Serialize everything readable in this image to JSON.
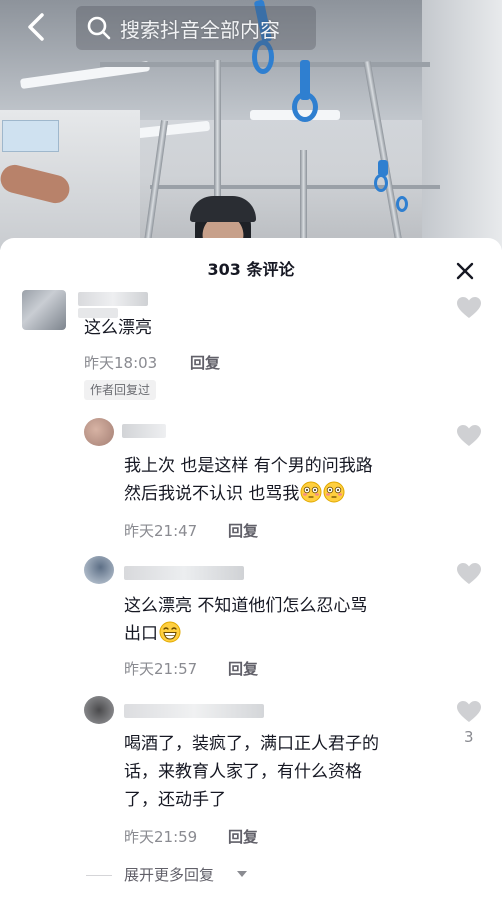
{
  "search": {
    "placeholder": "搜索抖音全部内容"
  },
  "comments_panel": {
    "title": "303 条评论",
    "comments": [
      {
        "text": "这么漂亮",
        "time": "昨天18:03",
        "reply_label": "回复",
        "badge": "作者回复过"
      }
    ],
    "replies": [
      {
        "text_line1": "我上次 也是这样 有个男的问我路",
        "text_line2": "然后我说不认识 也骂我",
        "emoji": [
          "flushed-face",
          "flushed-face"
        ],
        "time": "昨天21:47",
        "reply_label": "回复"
      },
      {
        "text_line1": "这么漂亮 不知道他们怎么忍心骂",
        "text_line2": "出口",
        "emoji": [
          "grinning-face"
        ],
        "time": "昨天21:57",
        "reply_label": "回复"
      },
      {
        "text_line1": "喝酒了，装疯了，满口正人君子的",
        "text_line2": "话，来教育人家了，有什么资格",
        "text_line3": "了，还动手了",
        "time": "昨天21:59",
        "reply_label": "回复",
        "likes": "3"
      }
    ],
    "expand_label": "展开更多回复"
  },
  "colors": {
    "text_primary": "#161823",
    "text_secondary": "#8a8b91",
    "like_icon": "#cfd0d3",
    "accent_handle": "#2f7fd0"
  }
}
